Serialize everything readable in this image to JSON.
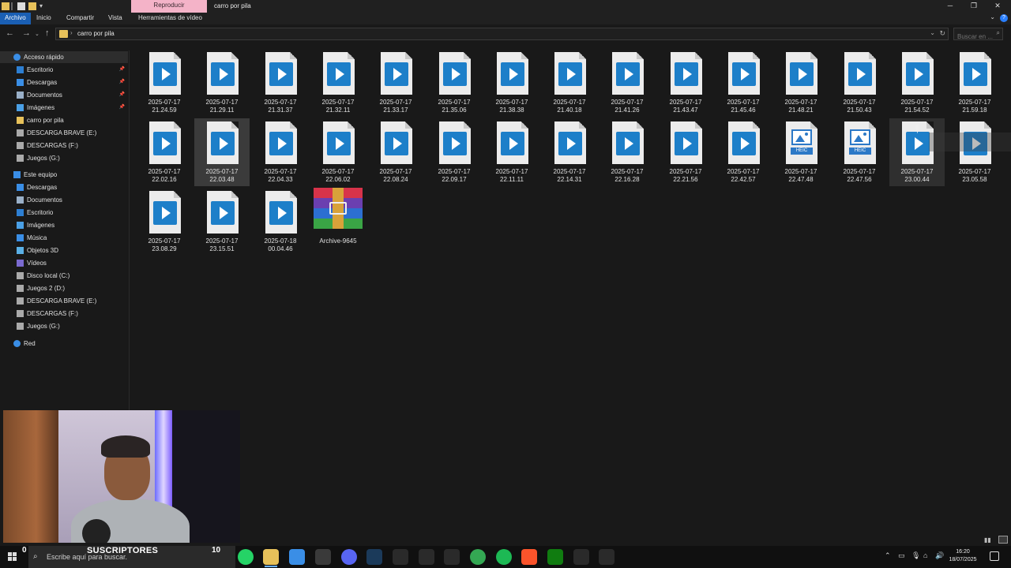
{
  "window": {
    "title": "carro por pila",
    "context_tab": "Reproducir",
    "minimize": "─",
    "maximize": "❐",
    "close": "✕"
  },
  "ribbon": {
    "tabs": [
      "Archivo",
      "Inicio",
      "Compartir",
      "Vista",
      "Herramientas de vídeo"
    ],
    "help": "?"
  },
  "address": {
    "path": "carro por pila",
    "separator": "›",
    "search_placeholder": "Buscar en ..."
  },
  "sidebar": {
    "items": [
      {
        "label": "Acceso rápido",
        "icon": "star-icon",
        "color": "#3a8ee6",
        "indent": 1,
        "selected": true,
        "pinned": false
      },
      {
        "label": "Escritorio",
        "icon": "desktop-icon",
        "color": "#2d7fd3",
        "indent": 2,
        "pinned": true
      },
      {
        "label": "Descargas",
        "icon": "download-icon",
        "color": "#3a8ee6",
        "indent": 2,
        "pinned": true
      },
      {
        "label": "Documentos",
        "icon": "documents-icon",
        "color": "#9ab0c8",
        "indent": 2,
        "pinned": true
      },
      {
        "label": "Imágenes",
        "icon": "pictures-icon",
        "color": "#4aa0e6",
        "indent": 2,
        "pinned": true
      },
      {
        "label": "carro por pila",
        "icon": "folder-icon",
        "color": "#e7c15a",
        "indent": 2,
        "pinned": false
      },
      {
        "label": "DESCARGA BRAVE (E:)",
        "icon": "drive-icon",
        "color": "#aaaaaa",
        "indent": 2,
        "pinned": false
      },
      {
        "label": "DESCARGAS (F:)",
        "icon": "drive-icon",
        "color": "#aaaaaa",
        "indent": 2,
        "pinned": false
      },
      {
        "label": "Juegos (G:)",
        "icon": "drive-icon",
        "color": "#aaaaaa",
        "indent": 2,
        "pinned": false
      },
      {
        "label": "Este equipo",
        "icon": "computer-icon",
        "color": "#3a8ee6",
        "indent": 1,
        "pinned": false
      },
      {
        "label": "Descargas",
        "icon": "download-icon",
        "color": "#3a8ee6",
        "indent": 2,
        "pinned": false
      },
      {
        "label": "Documentos",
        "icon": "documents-icon",
        "color": "#9ab0c8",
        "indent": 2,
        "pinned": false
      },
      {
        "label": "Escritorio",
        "icon": "desktop-icon",
        "color": "#2d7fd3",
        "indent": 2,
        "pinned": false
      },
      {
        "label": "Imágenes",
        "icon": "pictures-icon",
        "color": "#4aa0e6",
        "indent": 2,
        "pinned": false
      },
      {
        "label": "Música",
        "icon": "music-icon",
        "color": "#3a8ee6",
        "indent": 2,
        "pinned": false
      },
      {
        "label": "Objetos 3D",
        "icon": "cube-icon",
        "color": "#5ab0e6",
        "indent": 2,
        "pinned": false
      },
      {
        "label": "Vídeos",
        "icon": "video-icon",
        "color": "#7a6ad0",
        "indent": 2,
        "pinned": false
      },
      {
        "label": "Disco local (C:)",
        "icon": "drive-icon",
        "color": "#aaaaaa",
        "indent": 2,
        "pinned": false
      },
      {
        "label": "Juegos 2 (D:)",
        "icon": "drive-icon",
        "color": "#aaaaaa",
        "indent": 2,
        "pinned": false
      },
      {
        "label": "DESCARGA BRAVE (E:)",
        "icon": "drive-icon",
        "color": "#aaaaaa",
        "indent": 2,
        "pinned": false
      },
      {
        "label": "DESCARGAS (F:)",
        "icon": "drive-icon",
        "color": "#aaaaaa",
        "indent": 2,
        "pinned": false
      },
      {
        "label": "Juegos (G:)",
        "icon": "drive-icon",
        "color": "#aaaaaa",
        "indent": 2,
        "pinned": false
      },
      {
        "label": "Red",
        "icon": "network-icon",
        "color": "#3a8ee6",
        "indent": 1,
        "pinned": false
      }
    ]
  },
  "files": [
    {
      "name": [
        "2025-07-17",
        "21.24.59"
      ],
      "type": "video"
    },
    {
      "name": [
        "2025-07-17",
        "21.29.11"
      ],
      "type": "video"
    },
    {
      "name": [
        "2025-07-17",
        "21.31.37"
      ],
      "type": "video"
    },
    {
      "name": [
        "2025-07-17",
        "21.32.11"
      ],
      "type": "video"
    },
    {
      "name": [
        "2025-07-17",
        "21.33.17"
      ],
      "type": "video"
    },
    {
      "name": [
        "2025-07-17",
        "21.35.06"
      ],
      "type": "video"
    },
    {
      "name": [
        "2025-07-17",
        "21.38.38"
      ],
      "type": "video"
    },
    {
      "name": [
        "2025-07-17",
        "21.40.18"
      ],
      "type": "video"
    },
    {
      "name": [
        "2025-07-17",
        "21.41.26"
      ],
      "type": "video"
    },
    {
      "name": [
        "2025-07-17",
        "21.43.47"
      ],
      "type": "video"
    },
    {
      "name": [
        "2025-07-17",
        "21.45.46"
      ],
      "type": "video"
    },
    {
      "name": [
        "2025-07-17",
        "21.48.21"
      ],
      "type": "video"
    },
    {
      "name": [
        "2025-07-17",
        "21.50.43"
      ],
      "type": "video"
    },
    {
      "name": [
        "2025-07-17",
        "21.54.52"
      ],
      "type": "video"
    },
    {
      "name": [
        "2025-07-17",
        "21.59.18"
      ],
      "type": "video"
    },
    {
      "name": [
        "2025-07-17",
        "22.02.16"
      ],
      "type": "video"
    },
    {
      "name": [
        "2025-07-17",
        "22.03.48"
      ],
      "type": "video",
      "selected": true
    },
    {
      "name": [
        "2025-07-17",
        "22.04.33"
      ],
      "type": "video"
    },
    {
      "name": [
        "2025-07-17",
        "22.06.02"
      ],
      "type": "video"
    },
    {
      "name": [
        "2025-07-17",
        "22.08.24"
      ],
      "type": "video"
    },
    {
      "name": [
        "2025-07-17",
        "22.09.17"
      ],
      "type": "video"
    },
    {
      "name": [
        "2025-07-17",
        "22.11.11"
      ],
      "type": "video"
    },
    {
      "name": [
        "2025-07-17",
        "22.14.31"
      ],
      "type": "video"
    },
    {
      "name": [
        "2025-07-17",
        "22.16.28"
      ],
      "type": "video"
    },
    {
      "name": [
        "2025-07-17",
        "22.21.56"
      ],
      "type": "video"
    },
    {
      "name": [
        "2025-07-17",
        "22.42.57"
      ],
      "type": "video"
    },
    {
      "name": [
        "2025-07-17",
        "22.47.48"
      ],
      "type": "heic"
    },
    {
      "name": [
        "2025-07-17",
        "22.47.56"
      ],
      "type": "heic"
    },
    {
      "name": [
        "2025-07-17",
        "23.00.44"
      ],
      "type": "video",
      "hovered": true
    },
    {
      "name": [
        "2025-07-17",
        "23.05.58"
      ],
      "type": "video"
    },
    {
      "name": [
        "2025-07-17",
        "23.08.29"
      ],
      "type": "video"
    },
    {
      "name": [
        "2025-07-17",
        "23.15.51"
      ],
      "type": "video"
    },
    {
      "name": [
        "2025-07-18",
        "00.04.46"
      ],
      "type": "video"
    },
    {
      "name": [
        "Archive-9645"
      ],
      "type": "rar"
    }
  ],
  "heic_label": "HEIC",
  "overlay": {
    "subscriber_count": "0",
    "subscriber_label": "SUSCRIPTORES",
    "subscriber_goal": "10"
  },
  "taskbar": {
    "search_placeholder": "Escribe aquí para buscar.",
    "apps": [
      {
        "name": "task-view-icon",
        "color": "#2a2a2a"
      },
      {
        "name": "whatsapp-icon",
        "color": "#25d366"
      },
      {
        "name": "file-explorer-icon",
        "color": "#e7c15a",
        "active": true
      },
      {
        "name": "store-icon",
        "color": "#3a8ee6"
      },
      {
        "name": "obs-icon",
        "color": "#3a3a3a"
      },
      {
        "name": "discord-icon",
        "color": "#5865f2"
      },
      {
        "name": "steam-icon",
        "color": "#1b3a5a"
      },
      {
        "name": "epic-icon",
        "color": "#2a2a2a"
      },
      {
        "name": "camera-icon",
        "color": "#2a2a2a"
      },
      {
        "name": "capture-icon",
        "color": "#2a2a2a"
      },
      {
        "name": "chrome-icon",
        "color": "#34a853"
      },
      {
        "name": "spotify-icon",
        "color": "#1db954"
      },
      {
        "name": "brave-icon",
        "color": "#fb542b"
      },
      {
        "name": "xbox-icon",
        "color": "#107c10"
      },
      {
        "name": "capcut-icon",
        "color": "#2a2a2a"
      },
      {
        "name": "nvidia-icon",
        "color": "#2a2a2a"
      }
    ],
    "time": "16:20",
    "date": "18/07/2025"
  }
}
